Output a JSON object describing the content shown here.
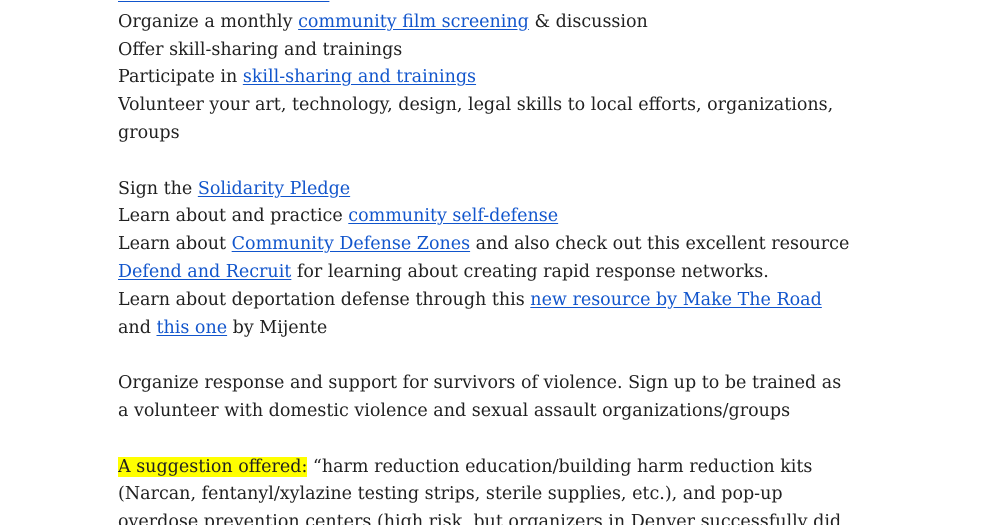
{
  "document": {
    "lines": [
      {
        "segments": [
          {
            "text": "Organize a monthly ",
            "link": false
          },
          {
            "text": "community film screening",
            "link": true
          },
          {
            "text": " & discussion",
            "link": false
          }
        ]
      },
      {
        "segments": [
          {
            "text": "Offer skill-sharing and trainings",
            "link": false
          }
        ]
      },
      {
        "segments": [
          {
            "text": "Participate in ",
            "link": false
          },
          {
            "text": "skill-sharing and trainings",
            "link": true
          }
        ]
      },
      {
        "segments": [
          {
            "text": "Volunteer your art, technology, design, legal skills to local efforts, organizations,",
            "link": false
          }
        ]
      },
      {
        "segments": [
          {
            "text": "groups",
            "link": false
          }
        ]
      },
      {
        "blank": true
      },
      {
        "segments": [
          {
            "text": "Sign the ",
            "link": false
          },
          {
            "text": "Solidarity Pledge",
            "link": true
          }
        ]
      },
      {
        "segments": [
          {
            "text": "Learn about and practice ",
            "link": false
          },
          {
            "text": "community self-defense",
            "link": true
          }
        ]
      },
      {
        "segments": [
          {
            "text": "Learn about ",
            "link": false
          },
          {
            "text": "Community Defense Zones",
            "link": true
          },
          {
            "text": " and also check out this excellent resource",
            "link": false
          }
        ]
      },
      {
        "segments": [
          {
            "text": "Defend and Recruit",
            "link": true
          },
          {
            "text": " for learning about creating rapid response networks.",
            "link": false
          }
        ]
      },
      {
        "segments": [
          {
            "text": "Learn about deportation defense through this ",
            "link": false
          },
          {
            "text": "new resource by Make The Road",
            "link": true
          }
        ]
      },
      {
        "segments": [
          {
            "text": "and ",
            "link": false
          },
          {
            "text": "this one",
            "link": true
          },
          {
            "text": " by Mijente",
            "link": false
          }
        ]
      },
      {
        "blank": true
      },
      {
        "segments": [
          {
            "text": "Organize response and support for survivors of violence. Sign up to be trained as",
            "link": false
          }
        ]
      },
      {
        "segments": [
          {
            "text": "a volunteer with domestic violence and sexual assault organizations/groups",
            "link": false
          }
        ]
      },
      {
        "blank": true
      },
      {
        "segments": [
          {
            "text": "A suggestion offered:",
            "link": false,
            "highlight": true
          },
          {
            "text": " “harm reduction education/building harm reduction kits",
            "link": false
          }
        ]
      },
      {
        "segments": [
          {
            "text": "(Narcan, fentanyl/xylazine testing strips, sterile supplies, etc.), and pop-up",
            "link": false
          }
        ]
      },
      {
        "segments": [
          {
            "text": "overdose prevention centers (high risk, but organizers in Denver successfully did",
            "link": false
          }
        ]
      }
    ]
  },
  "colors": {
    "link": "#1155cc",
    "highlight": "#ffff00",
    "text": "#202020"
  }
}
